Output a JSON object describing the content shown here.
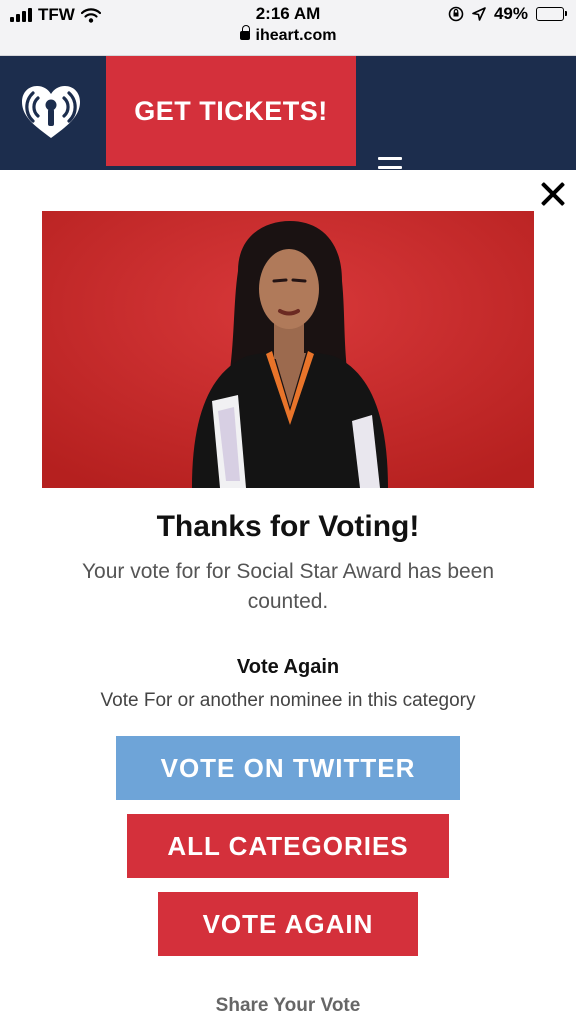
{
  "status_bar": {
    "carrier": "TFW",
    "time": "2:16 AM",
    "url": "iheart.com",
    "battery": "49%",
    "battery_level": 0.49
  },
  "header": {
    "tickets_label": "GET TICKETS!",
    "colors": {
      "background": "#1c2d4d",
      "accent": "#d4303b"
    }
  },
  "modal": {
    "title": "Thanks for Voting!",
    "message": "Your vote for for Social Star Award has been counted.",
    "vote_again_heading": "Vote Again",
    "vote_again_sub": "Vote For or another nominee in this category",
    "buttons": {
      "twitter": "VOTE ON TWITTER",
      "categories": "ALL CATEGORIES",
      "vote_again": "VOTE AGAIN"
    },
    "share_heading": "Share Your Vote",
    "colors": {
      "twitter": "#6ea4d8",
      "primary": "#d4303b"
    }
  }
}
